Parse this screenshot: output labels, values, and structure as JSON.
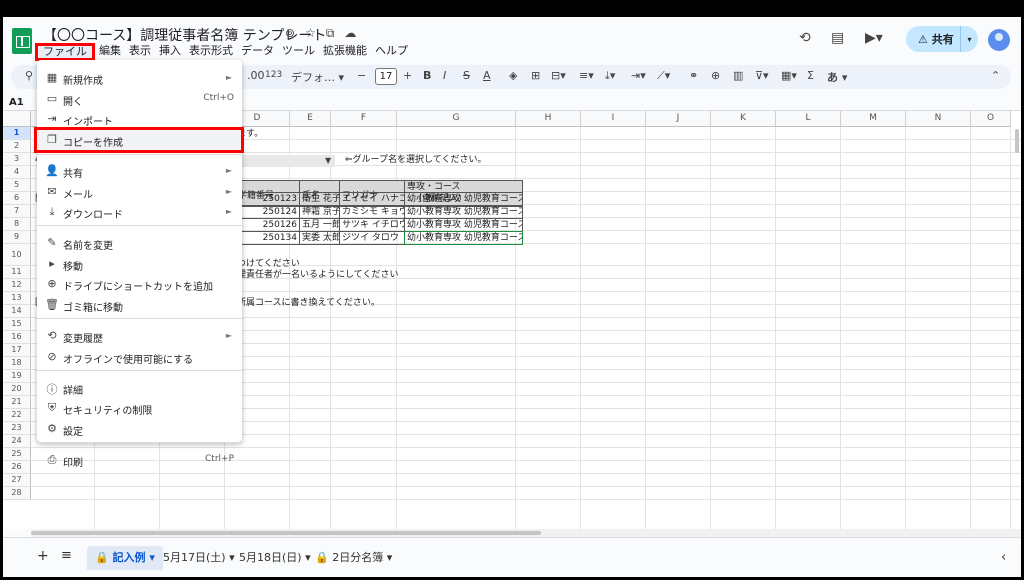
{
  "title": "【〇〇コース】調理従事者名簿 テンプレート",
  "menus": [
    "ファイル",
    "編集",
    "表示",
    "挿入",
    "表示形式",
    "データ",
    "ツール",
    "拡張機能",
    "ヘルプ"
  ],
  "share_label": "共有",
  "toolbar": {
    "zoom": "123",
    "font": "デフォ…",
    "font_size": "17",
    "input_lang": "あ"
  },
  "namebox": "A1",
  "columns": [
    "A",
    "B",
    "C",
    "D",
    "E",
    "F",
    "G",
    "H",
    "I",
    "J",
    "K",
    "L",
    "M",
    "N",
    "O"
  ],
  "rows": [
    "1",
    "2",
    "3",
    "4",
    "5",
    "6",
    "7",
    "8",
    "9",
    "10",
    "11",
    "12",
    "13",
    "14",
    "15",
    "16",
    "17",
    "18",
    "19",
    "20",
    "21",
    "22",
    "23",
    "24",
    "25",
    "26",
    "27",
    "28"
  ],
  "sheet": {
    "r1_text": "ます。",
    "r3_hint": "⇐グループ名を選択してください。",
    "col_hdr_d": "学籍番号",
    "col_hdr_e": "氏名",
    "col_hdr_f": "フリガナ",
    "col_hdr_g1": "専攻・コース",
    "col_hdr_g2": "（自動記入）",
    "data": [
      {
        "id": "250123",
        "name": "衛生 花子",
        "kana": "エイセイ ハナコ",
        "course": "幼小教育専攻 幼児教育コース"
      },
      {
        "id": "250124",
        "name": "神霜 京子",
        "kana": "カミシモ キョウ",
        "course": "幼小教育専攻 幼児教育コース"
      },
      {
        "id": "250126",
        "name": "五月 一郎",
        "kana": "サツキ イチロウ",
        "course": "幼小教育専攻 幼児教育コース"
      },
      {
        "id": "250134",
        "name": "実委 太郎",
        "kana": "ジツイ タロウ",
        "course": "幼小教育専攻 幼児教育コース"
      }
    ],
    "r10_text": "つけてください",
    "r10b_text": "理責任者が一名いるようにしてください",
    "r12_text": "所属コースに書き換えてください。",
    "a3_frag": "4",
    "a5_frag": "開",
    "a12_frag": "回"
  },
  "file_menu": [
    {
      "icon": "▦",
      "label": "新規作成",
      "submenu": true
    },
    {
      "icon": "▭",
      "label": "開く",
      "shortcut": "Ctrl+O"
    },
    {
      "icon": "⇥",
      "label": "インポート"
    },
    {
      "icon": "❐",
      "label": "コピーを作成"
    },
    {
      "icon": "👤",
      "label": "共有",
      "submenu": true
    },
    {
      "icon": "✉",
      "label": "メール",
      "submenu": true
    },
    {
      "icon": "⤓",
      "label": "ダウンロード",
      "submenu": true
    },
    {
      "icon": "✎",
      "label": "名前を変更"
    },
    {
      "icon": "▸",
      "label": "移動"
    },
    {
      "icon": "⊕",
      "label": "ドライブにショートカットを追加"
    },
    {
      "icon": "🗑",
      "label": "ゴミ箱に移動"
    },
    {
      "icon": "⟲",
      "label": "変更履歴",
      "submenu": true
    },
    {
      "icon": "⊘",
      "label": "オフラインで使用可能にする"
    },
    {
      "icon": "ⓘ",
      "label": "詳細"
    },
    {
      "icon": "⛨",
      "label": "セキュリティの制限"
    },
    {
      "icon": "⚙",
      "label": "設定"
    },
    {
      "icon": "⎙",
      "label": "印刷",
      "shortcut": "Ctrl+P"
    }
  ],
  "tabs": [
    "記入例",
    "5月17日(土)",
    "5月18日(日)",
    "2日分名簿"
  ],
  "accent": "#0b57d0",
  "highlight": "#ff0000"
}
